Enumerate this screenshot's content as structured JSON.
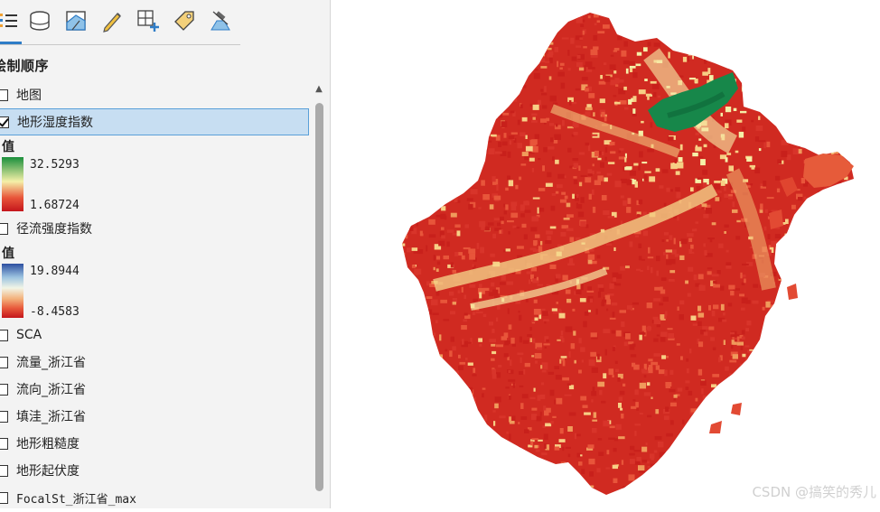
{
  "panel": {
    "title": "绘制顺序",
    "layers": [
      {
        "label": "地图",
        "checked": false,
        "selected": false
      },
      {
        "label": "地形湿度指数",
        "checked": true,
        "selected": true
      },
      {
        "label": "径流强度指数",
        "checked": false,
        "selected": false
      },
      {
        "label": "SCA",
        "checked": false,
        "selected": false
      },
      {
        "label": "流量_浙江省",
        "checked": false,
        "selected": false
      },
      {
        "label": "流向_浙江省",
        "checked": false,
        "selected": false
      },
      {
        "label": "填洼_浙江省",
        "checked": false,
        "selected": false
      },
      {
        "label": "地形粗糙度",
        "checked": false,
        "selected": false
      },
      {
        "label": "地形起伏度",
        "checked": false,
        "selected": false
      },
      {
        "label": "FocalSt_浙江省_max",
        "checked": false,
        "selected": false
      }
    ],
    "legends": [
      {
        "heading": "值",
        "high": "32.5293",
        "low": "1.68724",
        "ramp": [
          "#1a8f3c",
          "#f5f0a8",
          "#e8553a",
          "#c4161c"
        ]
      },
      {
        "heading": "值",
        "high": "19.8944",
        "low": "-8.4583",
        "ramp": [
          "#2c4fa0",
          "#f2f5e6",
          "#e85a3c",
          "#c4161c"
        ]
      }
    ]
  },
  "toolbar": {
    "icons": [
      "list-by-drawing-order-icon",
      "database-icon",
      "layer-style-icon",
      "edit-pencil-icon",
      "add-grid-icon",
      "label-tag-icon",
      "satellite-icon"
    ]
  },
  "map": {
    "palette": [
      "#c8201b",
      "#d8342a",
      "#e8553a",
      "#f09a5b",
      "#f7cf85",
      "#f5f0a8",
      "#1a8f3c"
    ]
  },
  "watermark": "CSDN @搞笑的秀儿"
}
